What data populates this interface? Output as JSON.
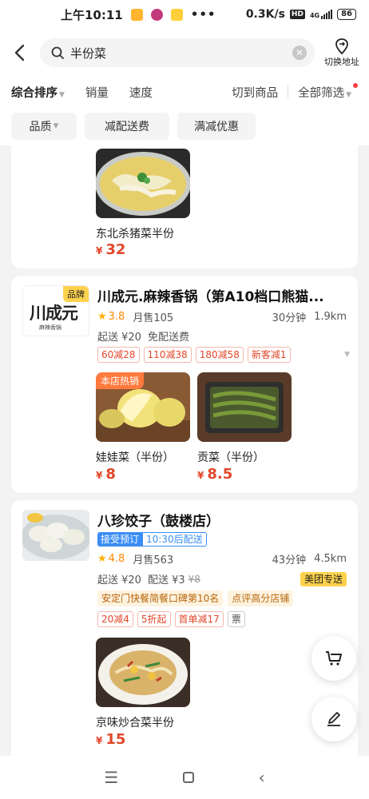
{
  "status_bar": {
    "time": "上午10:11",
    "network_speed": "0.3K/s",
    "hd_label": "HD",
    "signal_label": "4G",
    "battery": "86"
  },
  "search": {
    "query": "半份菜",
    "switch_address_label": "切换地址"
  },
  "sort_bar": {
    "items": [
      "综合排序",
      "销量",
      "速度"
    ],
    "switch_goods": "切到商品",
    "all_filter": "全部筛选"
  },
  "filter_chips": [
    "品质",
    "减配送费",
    "满减优惠"
  ],
  "card1": {
    "dish": {
      "name": "东北杀猪菜半份",
      "currency": "¥",
      "price": "32",
      "icon": "sauerkraut-pork-dish-image"
    }
  },
  "card2": {
    "brand_badge": "品牌",
    "logo_text": "川成元",
    "logo_sub": "麻辣香锅",
    "title": "川成元.麻辣香锅（第A10档口熊猫...",
    "rating": "3.8",
    "monthly_sales": "月售105",
    "delivery_time": "30分钟",
    "distance": "1.9km",
    "min_order": "起送 ¥20",
    "delivery_fee": "免配送费",
    "promos": [
      "60减28",
      "110减38",
      "180减58",
      "新客减1"
    ],
    "dishes": [
      {
        "name": "娃娃菜（半份）",
        "currency": "¥",
        "price": "8",
        "badge": "本店热销",
        "icon": "baby-cabbage-image"
      },
      {
        "name": "贡菜（半份）",
        "currency": "¥",
        "price": "8.5",
        "badge": "",
        "icon": "gongcai-image"
      }
    ]
  },
  "card3": {
    "title": "八珍饺子（鼓楼店）",
    "preorder": "接受预订",
    "delivery_slot": "10:30后配送",
    "rating": "4.8",
    "monthly_sales": "月售563",
    "delivery_time": "43分钟",
    "distance": "4.5km",
    "min_order": "起送 ¥20",
    "delivery_fee": "配送 ¥3",
    "original_fee": "¥8",
    "meituan_badge": "美团专送",
    "rank_tags": [
      "安定门快餐简餐口碑第10名",
      "点评高分店铺"
    ],
    "promos": [
      "20减4",
      "5折起",
      "首单减17"
    ],
    "invoice_tag": "票",
    "dish": {
      "name": "京味炒合菜半份",
      "currency": "¥",
      "price": "15",
      "icon": "stir-fried-vegetables-image"
    }
  },
  "colors": {
    "price_red": "#e2472b",
    "brand_yellow": "#ffd24d",
    "star_orange": "#ffb000",
    "preorder_blue": "#3a8df5"
  }
}
